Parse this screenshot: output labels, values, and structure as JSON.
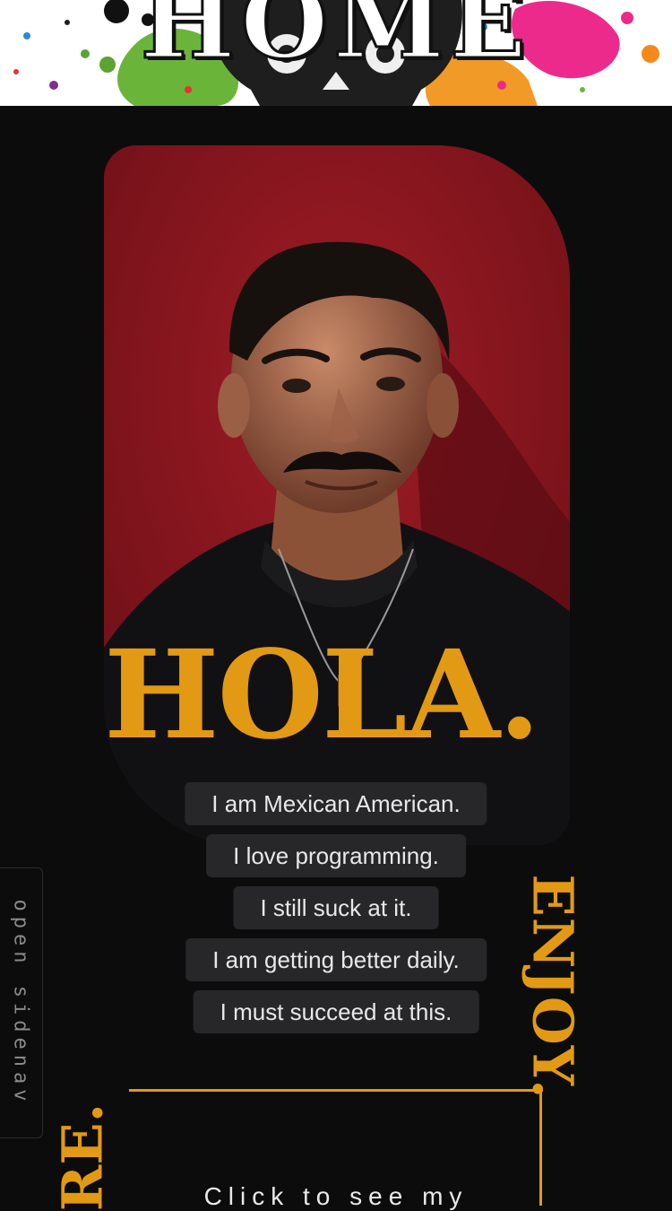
{
  "header": {
    "title": "HOME"
  },
  "hero": {
    "headline": "HOLA."
  },
  "statements": [
    "I am Mexican American.",
    "I love programming.",
    "I still suck at it.",
    "I am getting better daily.",
    "I must succeed at this."
  ],
  "side": {
    "sidenav_label": "open sidenav",
    "enjoy": "ENJOY.",
    "partial_word": "RE."
  },
  "cta": {
    "label": "Click to see my"
  },
  "colors": {
    "accent": "#e29a14",
    "background": "#0c0c0c",
    "pill": "#272729",
    "portrait_bg": "#8e1820"
  }
}
